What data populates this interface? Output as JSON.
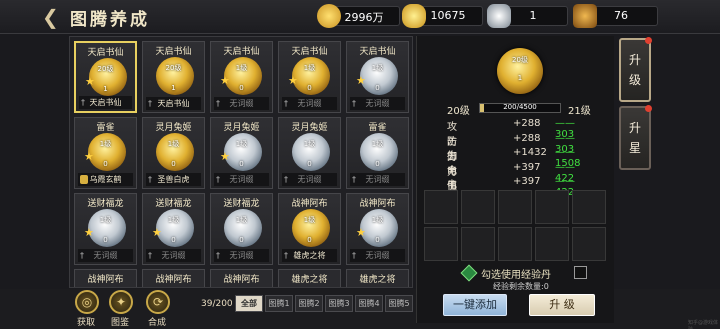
{
  "header": {
    "title": "图腾养成",
    "back_icon": "back-arrow-icon"
  },
  "resources": [
    {
      "icon": "gold-coin-icon",
      "value": "2996万",
      "color": "#f0c040"
    },
    {
      "icon": "gold-ingot-icon",
      "value": "10675",
      "color": "#e8b830"
    },
    {
      "icon": "silver-ore-icon",
      "value": "1",
      "color": "#c0c8d0"
    },
    {
      "icon": "treasure-chest-icon",
      "value": "76",
      "color": "#c88830"
    }
  ],
  "totems": [
    {
      "name": "天启书仙",
      "level": "20级",
      "count": "1",
      "medal": "gold",
      "star": true,
      "tag": "天启书仙",
      "tag_active": true,
      "tag_icon": "sword"
    },
    {
      "name": "天启书仙",
      "level": "20级",
      "count": "1",
      "medal": "gold",
      "star": false,
      "tag": "天启书仙",
      "tag_active": true,
      "tag_icon": "sword"
    },
    {
      "name": "天启书仙",
      "level": "1级",
      "count": "0",
      "medal": "gold",
      "star": true,
      "tag": "无词缀",
      "tag_active": false,
      "tag_icon": "sword"
    },
    {
      "name": "天启书仙",
      "level": "1级",
      "count": "0",
      "medal": "gold",
      "star": true,
      "tag": "无词缀",
      "tag_active": false,
      "tag_icon": "sword"
    },
    {
      "name": "天启书仙",
      "level": "1级",
      "count": "0",
      "medal": "silver",
      "star": true,
      "tag": "无词缀",
      "tag_active": false,
      "tag_icon": "sword"
    },
    {
      "name": "雷雀",
      "level": "1级",
      "count": "0",
      "medal": "gold",
      "star": true,
      "tag": "乌霞玄鹤",
      "tag_active": true,
      "tag_icon": "badge"
    },
    {
      "name": "灵月兔姬",
      "level": "1级",
      "count": "0",
      "medal": "gold",
      "star": false,
      "tag": "圣兽白虎",
      "tag_active": true,
      "tag_icon": "sword"
    },
    {
      "name": "灵月兔姬",
      "level": "1级",
      "count": "0",
      "medal": "silver",
      "star": true,
      "tag": "无词缀",
      "tag_active": false,
      "tag_icon": "sword"
    },
    {
      "name": "灵月兔姬",
      "level": "1级",
      "count": "0",
      "medal": "silver",
      "star": false,
      "tag": "无词缀",
      "tag_active": false,
      "tag_icon": "sword"
    },
    {
      "name": "雷雀",
      "level": "1级",
      "count": "0",
      "medal": "silver",
      "star": false,
      "tag": "无词缀",
      "tag_active": false,
      "tag_icon": "sword"
    },
    {
      "name": "送财福龙",
      "level": "1级",
      "count": "0",
      "medal": "silver",
      "star": true,
      "tag": "无词缀",
      "tag_active": false,
      "tag_icon": "sword"
    },
    {
      "name": "送财福龙",
      "level": "1级",
      "count": "0",
      "medal": "silver",
      "star": true,
      "tag": "无词缀",
      "tag_active": false,
      "tag_icon": "sword"
    },
    {
      "name": "送财福龙",
      "level": "1级",
      "count": "0",
      "medal": "silver",
      "star": false,
      "tag": "无词缀",
      "tag_active": false,
      "tag_icon": "sword"
    },
    {
      "name": "战神阿布",
      "level": "1级",
      "count": "0",
      "medal": "gold",
      "star": false,
      "tag": "雄虎之将",
      "tag_active": true,
      "tag_icon": "sword"
    },
    {
      "name": "战神阿布",
      "level": "1级",
      "count": "0",
      "medal": "silver",
      "star": true,
      "tag": "无词缀",
      "tag_active": false,
      "tag_icon": "sword"
    }
  ],
  "partial_row": [
    "战神阿布",
    "战神阿布",
    "战神阿布",
    "雄虎之将",
    "雄虎之将"
  ],
  "bottom_actions": [
    {
      "label": "获取",
      "icon": "obtain-icon",
      "glyph": "◎"
    },
    {
      "label": "图鉴",
      "icon": "codex-icon",
      "glyph": "✦"
    },
    {
      "label": "合成",
      "icon": "synthesis-icon",
      "glyph": "⟳"
    }
  ],
  "page_count": "39/200",
  "filter_tabs": [
    "全部",
    "图腾1",
    "图腾2",
    "图腾3",
    "图腾4",
    "图腾5"
  ],
  "detail": {
    "medal_level": "20级",
    "medal_count": "1",
    "current_level": "20级",
    "next_level": "21级",
    "xp_text": "200/4500",
    "xp_fraction": 0.044,
    "stats": [
      {
        "name": "攻击力",
        "value": "+288",
        "next": "303"
      },
      {
        "name": "防御力",
        "value": "+288",
        "next": "303"
      },
      {
        "name": "生命值",
        "value": "+1432",
        "next": "1508"
      },
      {
        "name": "电伤害",
        "value": "+397",
        "next": "422"
      },
      {
        "name": "电防",
        "value": "+397",
        "next": "422"
      }
    ],
    "use_exp_label": "勾选使用经验丹",
    "remaining_label": "经验剩余数量:0",
    "one_click_label": "一键添加",
    "upgrade_label": "升 级"
  },
  "side_tabs": [
    {
      "label": "升级",
      "active": true
    },
    {
      "label": "升星",
      "active": false
    }
  ],
  "watermark": "知乎@游戏体验"
}
